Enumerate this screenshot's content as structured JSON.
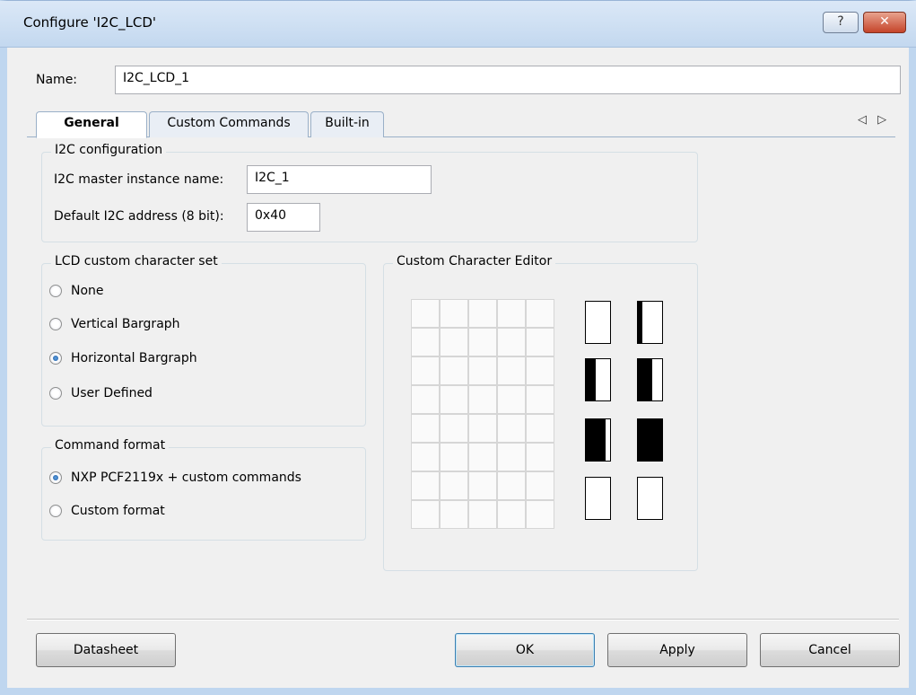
{
  "window": {
    "title": "Configure 'I2C_LCD'",
    "help_label": "?",
    "close_label": "✕"
  },
  "name_field": {
    "label": "Name:",
    "value": "I2C_LCD_1"
  },
  "tabs": [
    {
      "label": "General"
    },
    {
      "label": "Custom Commands"
    },
    {
      "label": "Built-in"
    }
  ],
  "tab_arrows": "◁ ▷",
  "i2c_config": {
    "title": "I2C configuration",
    "instance_label": "I2C master instance name:",
    "instance_value": "I2C_1",
    "address_label": "Default I2C address (8 bit):",
    "address_value": "0x40"
  },
  "charset": {
    "title": "LCD custom character set",
    "options": [
      {
        "label": "None",
        "checked": false
      },
      {
        "label": "Vertical Bargraph",
        "checked": false
      },
      {
        "label": "Horizontal Bargraph",
        "checked": true
      },
      {
        "label": "User Defined",
        "checked": false
      }
    ]
  },
  "command_format": {
    "title": "Command format",
    "options": [
      {
        "label": "NXP PCF2119x + custom commands",
        "checked": true
      },
      {
        "label": "Custom format",
        "checked": false
      }
    ]
  },
  "editor": {
    "title": "Custom Character Editor",
    "grid_columns": 5,
    "grid_rows": 8,
    "preview_fill_fractions": [
      0.0,
      0.2,
      0.4,
      0.6,
      0.8,
      1.0,
      0.0,
      0.0
    ]
  },
  "buttons": {
    "datasheet": "Datasheet",
    "ok": "OK",
    "apply": "Apply",
    "cancel": "Cancel"
  }
}
